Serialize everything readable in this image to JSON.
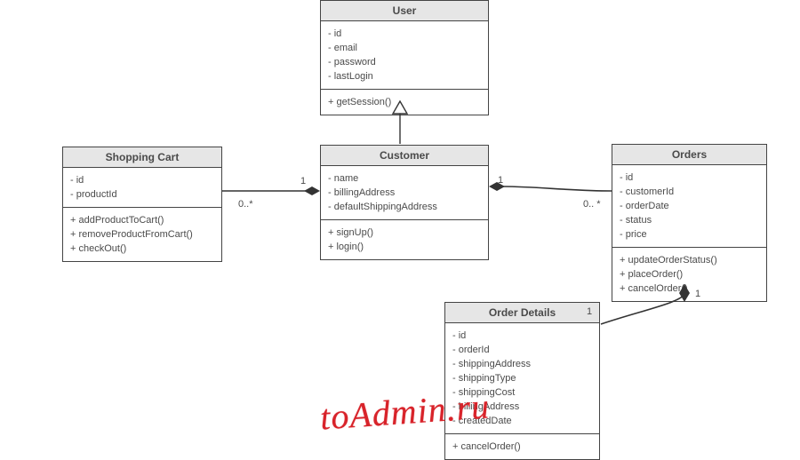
{
  "classes": {
    "user": {
      "title": "User",
      "attrs": [
        "- id",
        "- email",
        "- password",
        "- lastLogin"
      ],
      "ops": [
        "+ getSession()"
      ]
    },
    "customer": {
      "title": "Customer",
      "attrs": [
        "- name",
        "- billingAddress",
        "- defaultShippingAddress"
      ],
      "ops": [
        "+ signUp()",
        "+ login()"
      ]
    },
    "cart": {
      "title": "Shopping Cart",
      "attrs": [
        "- id",
        "- productId"
      ],
      "ops": [
        "+ addProductToCart()",
        "+ removeProductFromCart()",
        "+ checkOut()"
      ]
    },
    "orders": {
      "title": "Orders",
      "attrs": [
        "- id",
        "- customerId",
        "- orderDate",
        "- status",
        "- price"
      ],
      "ops": [
        "+ updateOrderStatus()",
        "+ placeOrder()",
        "+ cancelOrder()"
      ]
    },
    "orderDetails": {
      "title": "Order Details",
      "attrs": [
        "- id",
        "- orderId",
        "- shippingAddress",
        "- shippingType",
        "- shippingCost",
        "- billingAddress",
        "- createdDate"
      ],
      "ops": [
        "+ cancelOrder()"
      ]
    }
  },
  "mult": {
    "cart_customer_left": "0..*",
    "cart_customer_right": "1",
    "customer_orders_left": "1",
    "customer_orders_right": "0.. *",
    "orders_details_top": "1",
    "orders_details_bottom": "1"
  },
  "watermark": "toAdmin.ru"
}
